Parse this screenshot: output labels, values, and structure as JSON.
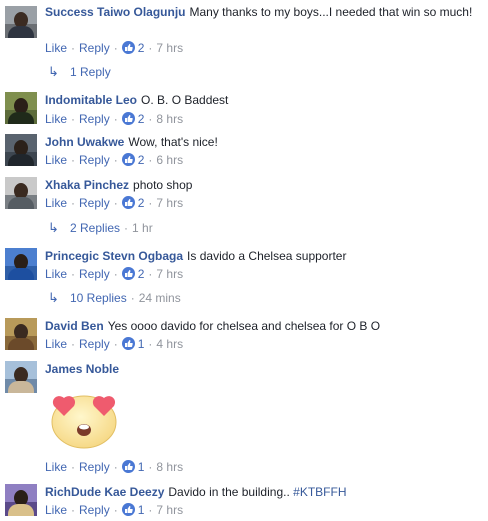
{
  "labels": {
    "like": "Like",
    "reply": "Reply",
    "sep": "·"
  },
  "comments": [
    {
      "author": "Success Taiwo Olagunju",
      "text": "Many thanks to my boys...I needed that win so much!",
      "likes": "2",
      "time": "7 hrs",
      "replies": "1 Reply",
      "replies_time": ""
    },
    {
      "author": "Indomitable Leo",
      "text": "O. B. O Baddest",
      "likes": "2",
      "time": "8 hrs"
    },
    {
      "author": "John Uwakwe",
      "text": "Wow, that's nice!",
      "likes": "2",
      "time": "6 hrs"
    },
    {
      "author": "Xhaka Pinchez",
      "text": "photo shop",
      "likes": "2",
      "time": "7 hrs",
      "replies": "2 Replies",
      "replies_time": "1 hr"
    },
    {
      "author": "Princegic Stevn Ogbaga",
      "text": "Is davido a Chelsea supporter",
      "likes": "2",
      "time": "7 hrs",
      "replies": "10 Replies",
      "replies_time": "24 mins"
    },
    {
      "author": "David Ben",
      "text": "Yes oooo davido for chelsea and chelsea for O B O",
      "likes": "1",
      "time": "4 hrs"
    },
    {
      "author": "James Noble",
      "text": "",
      "likes": "1",
      "time": "8 hrs",
      "sticker": "heart-eyes-emoji"
    },
    {
      "author": "RichDude Kae Deezy",
      "text": "Davido in the building..",
      "hashtag": "#KTBFFH",
      "likes": "1",
      "time": "7 hrs"
    }
  ],
  "colors": {
    "link": "#365899",
    "action": "#4267b2",
    "muted": "#90949c",
    "like_badge": "#4a78d4"
  }
}
